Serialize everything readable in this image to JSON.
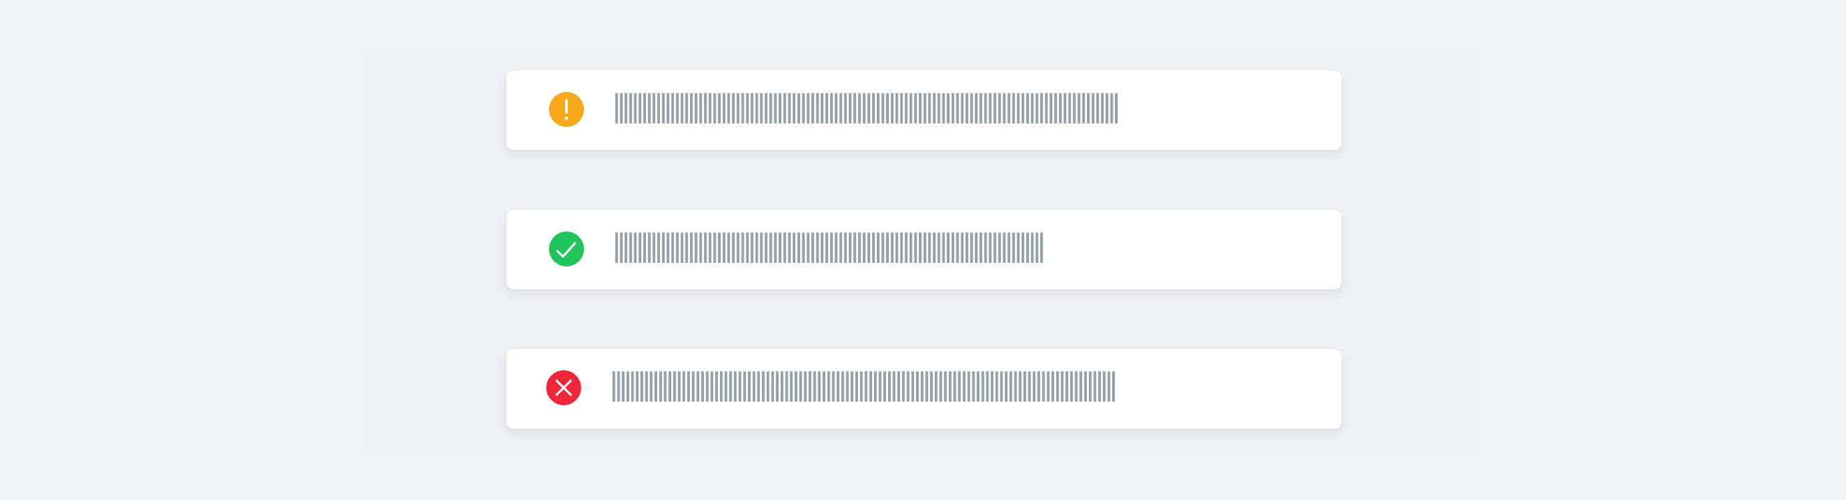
{
  "notifications": [
    {
      "type": "warning",
      "icon": "warning-icon",
      "color": "#f7a81b",
      "message": "||||||||||||||||||||||||||||||||||||||||||||||||||||||||||||||||||||||||||||||||||||||||||||||||||||||||||||"
    },
    {
      "type": "success",
      "icon": "check-circle-icon",
      "color": "#1fc45a",
      "message": "||||||||||||||||||||||||||||||||||||||||||||||||||||||||||||||||||||||||||||||||||||||||||||"
    },
    {
      "type": "error",
      "icon": "error-circle-icon",
      "color": "#f2263a",
      "message": "||||||||||||||||||||||||||||||||||||||||||||||||||||||||||||||||||||||||||||||||||||||||||||||||||||||||||||"
    }
  ]
}
